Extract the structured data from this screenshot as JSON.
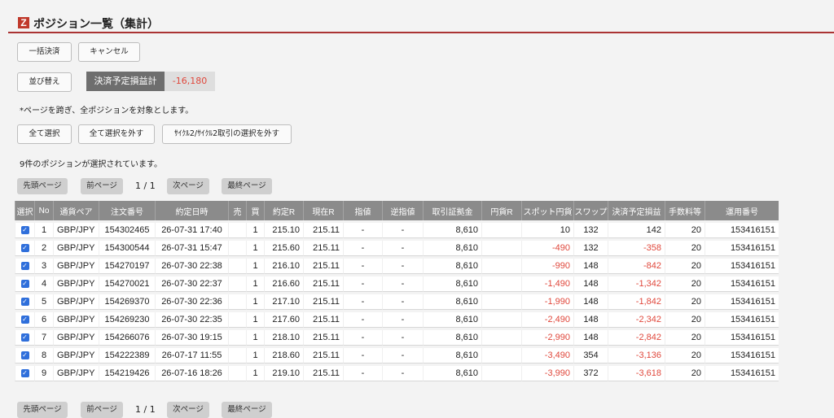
{
  "header": {
    "logo": "Z",
    "title": "ポジション一覧（集計）"
  },
  "buttons": {
    "bulk_settle": "一括決済",
    "cancel": "キャンセル",
    "sort": "並び替え",
    "select_all": "全て選択",
    "deselect_all": "全て選択を外す",
    "deselect_cycle": "ｻｲｸﾙ2/ｻｲｸﾙ2取引の選択を外す"
  },
  "summary": {
    "label": "決済予定損益計",
    "value": "-16,180"
  },
  "notes": {
    "cross_page": "*ページを跨ぎ、全ポジションを対象とします。",
    "selected": "9件のポジションが選択されています。"
  },
  "pager": {
    "first": "先頭ページ",
    "prev": "前ページ",
    "info": "1 / 1",
    "next": "次ページ",
    "last": "最終ページ"
  },
  "table": {
    "headers": [
      "選択",
      "No",
      "通貨ペア",
      "注文番号",
      "約定日時",
      "売",
      "買",
      "約定R",
      "現在R",
      "指値",
      "逆指値",
      "取引証拠金",
      "円貨R",
      "スポット円貨",
      "スワップ",
      "決済予定損益",
      "手数料等",
      "運用番号"
    ],
    "rows": [
      [
        "1",
        "GBP/JPY",
        "154302465",
        "26-07-31 17:40",
        "",
        "1",
        "215.10",
        "215.11",
        "-",
        "-",
        "8,610",
        "",
        "10",
        "132",
        "142",
        "20",
        "153416151"
      ],
      [
        "2",
        "GBP/JPY",
        "154300544",
        "26-07-31 15:47",
        "",
        "1",
        "215.60",
        "215.11",
        "-",
        "-",
        "8,610",
        "",
        "-490",
        "132",
        "-358",
        "20",
        "153416151"
      ],
      [
        "3",
        "GBP/JPY",
        "154270197",
        "26-07-30 22:38",
        "",
        "1",
        "216.10",
        "215.11",
        "-",
        "-",
        "8,610",
        "",
        "-990",
        "148",
        "-842",
        "20",
        "153416151"
      ],
      [
        "4",
        "GBP/JPY",
        "154270021",
        "26-07-30 22:37",
        "",
        "1",
        "216.60",
        "215.11",
        "-",
        "-",
        "8,610",
        "",
        "-1,490",
        "148",
        "-1,342",
        "20",
        "153416151"
      ],
      [
        "5",
        "GBP/JPY",
        "154269370",
        "26-07-30 22:36",
        "",
        "1",
        "217.10",
        "215.11",
        "-",
        "-",
        "8,610",
        "",
        "-1,990",
        "148",
        "-1,842",
        "20",
        "153416151"
      ],
      [
        "6",
        "GBP/JPY",
        "154269230",
        "26-07-30 22:35",
        "",
        "1",
        "217.60",
        "215.11",
        "-",
        "-",
        "8,610",
        "",
        "-2,490",
        "148",
        "-2,342",
        "20",
        "153416151"
      ],
      [
        "7",
        "GBP/JPY",
        "154266076",
        "26-07-30 19:15",
        "",
        "1",
        "218.10",
        "215.11",
        "-",
        "-",
        "8,610",
        "",
        "-2,990",
        "148",
        "-2,842",
        "20",
        "153416151"
      ],
      [
        "8",
        "GBP/JPY",
        "154222389",
        "26-07-17 11:55",
        "",
        "1",
        "218.60",
        "215.11",
        "-",
        "-",
        "8,610",
        "",
        "-3,490",
        "354",
        "-3,136",
        "20",
        "153416151"
      ],
      [
        "9",
        "GBP/JPY",
        "154219426",
        "26-07-16 18:26",
        "",
        "1",
        "219.10",
        "215.11",
        "-",
        "-",
        "8,610",
        "",
        "-3,990",
        "372",
        "-3,618",
        "20",
        "153416151"
      ]
    ]
  },
  "colors": {
    "accent": "#c0392b",
    "negative": "#e0483c",
    "checkbox": "#2f6fdb"
  }
}
